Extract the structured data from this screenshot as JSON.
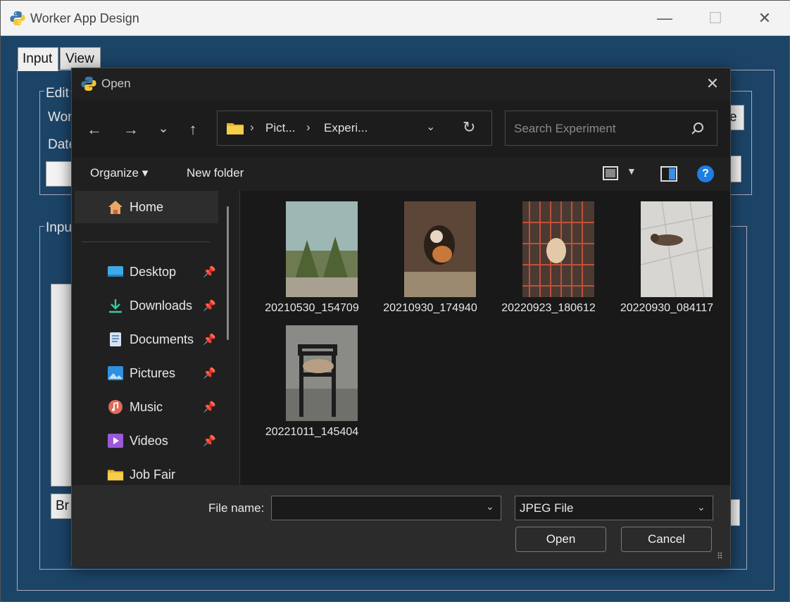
{
  "app": {
    "title": "Worker App Design",
    "min": "—",
    "max": "☐",
    "close": "✕"
  },
  "tabs": [
    {
      "label": "Input"
    },
    {
      "label": "View"
    }
  ],
  "background": {
    "group1_label": "Edit",
    "label_worker": "Wor",
    "label_date": "Date",
    "right_button": "e",
    "group2_label": "Inpu",
    "browse_button": "Br"
  },
  "dialog": {
    "title": "Open",
    "close": "✕",
    "nav": {
      "back": "←",
      "forward": "→",
      "recent": "⌄",
      "up": "↑"
    },
    "breadcrumbs": [
      {
        "label": "Pict..."
      },
      {
        "label": "Experi..."
      }
    ],
    "breadcrumb_sep": "›",
    "address_dropdown": "⌄",
    "refresh": "↻",
    "search_placeholder": "Search Experiment",
    "organize": "Organize ▾",
    "new_folder": "New folder",
    "view_dropdown": "▼",
    "help": "?",
    "sidebar": {
      "home": "Home",
      "pin": "📌",
      "items": [
        {
          "label": "Desktop",
          "icon": "desktop-icon",
          "pinned": true
        },
        {
          "label": "Downloads",
          "icon": "download-icon",
          "pinned": true
        },
        {
          "label": "Documents",
          "icon": "document-icon",
          "pinned": true
        },
        {
          "label": "Pictures",
          "icon": "pictures-icon",
          "pinned": true
        },
        {
          "label": "Music",
          "icon": "music-icon",
          "pinned": true
        },
        {
          "label": "Videos",
          "icon": "video-icon",
          "pinned": true
        },
        {
          "label": "Job Fair",
          "icon": "folder-icon",
          "pinned": false
        }
      ]
    },
    "files": [
      {
        "name": "20210530_154709"
      },
      {
        "name": "20210930_174940"
      },
      {
        "name": "20220923_180612"
      },
      {
        "name": "20220930_084117"
      },
      {
        "name": "20221011_145404"
      }
    ],
    "file_name_label": "File name:",
    "file_name_value": "",
    "file_type": "JPEG File",
    "dropdown_arrow": "⌄",
    "open_button": "Open",
    "cancel_button": "Cancel",
    "grip": "⠿"
  },
  "colors": {
    "app_bg": "#1c4467",
    "dialog_bg": "#202020",
    "accent": "#1e7fe0"
  }
}
